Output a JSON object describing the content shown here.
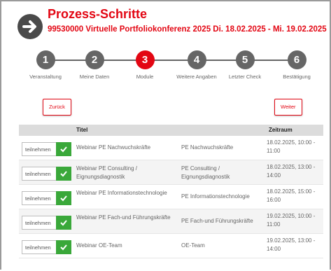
{
  "header": {
    "title": "Prozess-Schritte",
    "subtitle": "99530000 Virtuelle Portfoliokonferenz 2025 Di. 18.02.2025 - Mi. 19.02.2025"
  },
  "steps": [
    {
      "number": "1",
      "label": "Veranstaltung"
    },
    {
      "number": "2",
      "label": "Meine Daten"
    },
    {
      "number": "3",
      "label": "Module",
      "active": true
    },
    {
      "number": "4",
      "label": "Weitere Angaben"
    },
    {
      "number": "5",
      "label": "Letzter Check"
    },
    {
      "number": "6",
      "label": "Bestätigung"
    }
  ],
  "nav": {
    "back_label": "Zurück",
    "next_label": "Weiter"
  },
  "table": {
    "headers": {
      "titel": "Titel",
      "zeitraum": "Zeitraum"
    },
    "join_label": "teilnehmen",
    "rows": [
      {
        "title": "Webinar PE Nachwuchskräfte",
        "desc": "PE Nachwuchskräfte",
        "time": "18.02.2025, 10:00 - 11:00"
      },
      {
        "title": "Webinar PE Consulting / Eignungsdiagnostik",
        "desc": "PE Consulting / Eignungsdiagnostik",
        "time": "18.02.2025, 13:00 - 14:00"
      },
      {
        "title": "Webinar PE Informationstechnologie",
        "desc": "PE Informationstechnologie",
        "time": "18.02.2025, 15:00 - 16:00"
      },
      {
        "title": "Webinar PE Fach-und Führungskräfte",
        "desc": "PE Fach-und Führungskräfte",
        "time": "19.02.2025, 10:00 - 11:00"
      },
      {
        "title": "Webinar OE-Team",
        "desc": "OE-Team",
        "time": "19.02.2025, 13:00 - 14:00"
      }
    ]
  },
  "colors": {
    "accent": "#e30613",
    "step_inactive": "#666666",
    "check": "#3aa83a"
  },
  "icons": {
    "back": "arrow-right-circle-icon",
    "check": "checkmark-icon"
  }
}
